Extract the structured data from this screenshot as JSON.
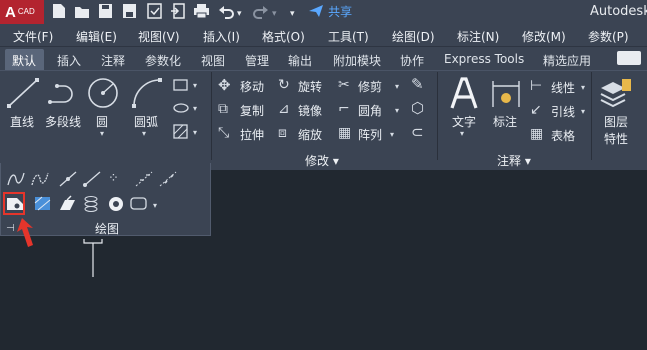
{
  "app": {
    "logo_text": "A",
    "logo_sub": "CAD",
    "share_label": "共享",
    "window_title": "Autodesk"
  },
  "menu": [
    "文件(F)",
    "编辑(E)",
    "视图(V)",
    "插入(I)",
    "格式(O)",
    "工具(T)",
    "绘图(D)",
    "标注(N)",
    "修改(M)",
    "参数(P)"
  ],
  "tabs": [
    "默认",
    "插入",
    "注释",
    "参数化",
    "视图",
    "管理",
    "输出",
    "附加模块",
    "协作",
    "Express Tools",
    "精选应用"
  ],
  "draw": {
    "line": "直线",
    "polyline": "多段线",
    "circle": "圆",
    "arc": "圆弧",
    "panel_title": "绘图"
  },
  "modify": {
    "move": "移动",
    "rotate": "旋转",
    "trim": "修剪",
    "copy": "复制",
    "mirror": "镜像",
    "fillet": "圆角",
    "stretch": "拉伸",
    "scale": "缩放",
    "array": "阵列",
    "panel_title": "修改"
  },
  "annotation": {
    "text": "文字",
    "dimension": "标注",
    "linear": "线性",
    "leader": "引线",
    "table": "表格",
    "panel_title": "注释"
  },
  "layers": {
    "properties": "图层",
    "properties_line2": "特性"
  },
  "colors": {
    "accent_blue": "#5aa8ff",
    "highlight_red": "#e5352b",
    "ribbon_bg": "#3b4453",
    "canvas_bg": "#212830"
  }
}
